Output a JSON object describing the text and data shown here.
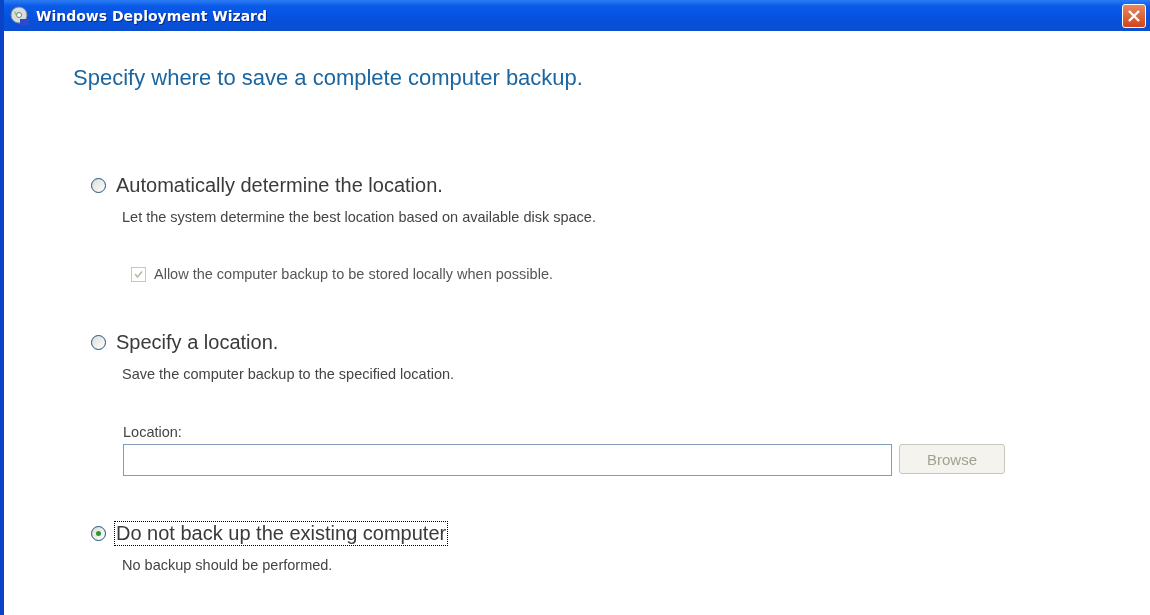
{
  "window": {
    "title": "Windows Deployment Wizard"
  },
  "heading": "Specify where to save a complete computer backup.",
  "options": [
    {
      "kind": "auto",
      "label": "Automatically determine the location.",
      "description": "Let the system determine the best location based on available disk space.",
      "selected": false,
      "focused": false,
      "checkbox": {
        "label": "Allow the computer backup to be stored locally when possible.",
        "checked": true,
        "disabled": true
      }
    },
    {
      "kind": "location",
      "label": "Specify a location.",
      "description": "Save the computer backup to the specified location.",
      "selected": false,
      "focused": false,
      "field": {
        "label": "Location:",
        "button": "Browse",
        "button_disabled": true
      }
    },
    {
      "kind": "none",
      "label": "Do not back up the existing computer",
      "description": "No backup should be performed.",
      "selected": true,
      "focused": true
    }
  ]
}
